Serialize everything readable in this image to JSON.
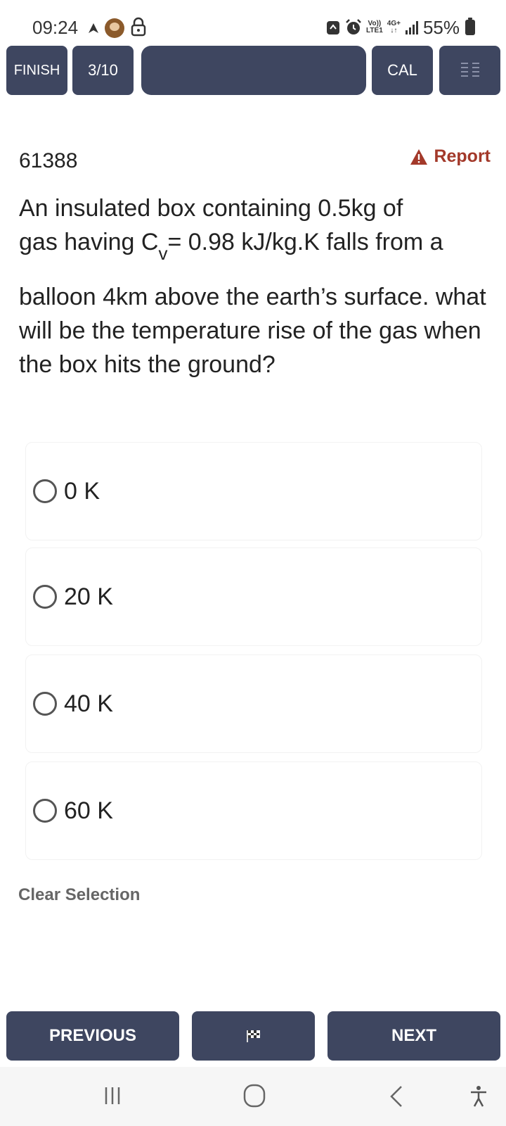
{
  "status_bar": {
    "time": "09:24",
    "network": {
      "volte": "Vo))",
      "lte": "LTE1",
      "gen": "4G+",
      "arrows": "↓↑"
    },
    "battery": "55%"
  },
  "toolbar": {
    "finish_label": "FINISH",
    "question_counter": "3/10",
    "calculator_label": "CAL"
  },
  "question": {
    "id": "61388",
    "report_label": "Report",
    "text_line1": "An insulated box containing 0.5kg of",
    "text_line2_pre": "gas having C",
    "text_line2_sub": "v",
    "text_line2_post": "= 0.98 kJ/kg.K falls from a",
    "text_rest": "balloon 4km above the earth’s surface. what will be the temperature rise of the gas when the box hits the ground?"
  },
  "options": [
    {
      "label": "0 K",
      "selected": false
    },
    {
      "label": "20 K",
      "selected": false
    },
    {
      "label": "40 K",
      "selected": false
    },
    {
      "label": "60 K",
      "selected": false
    }
  ],
  "clear_selection_label": "Clear Selection",
  "bottom_nav": {
    "previous_label": "PREVIOUS",
    "next_label": "NEXT"
  },
  "icons": {
    "report": "warning-triangle-icon",
    "flag": "checkered-flag-icon",
    "menu": "grid-menu-icon"
  },
  "colors": {
    "button_bg": "#3e4660",
    "report": "#a3392a"
  }
}
